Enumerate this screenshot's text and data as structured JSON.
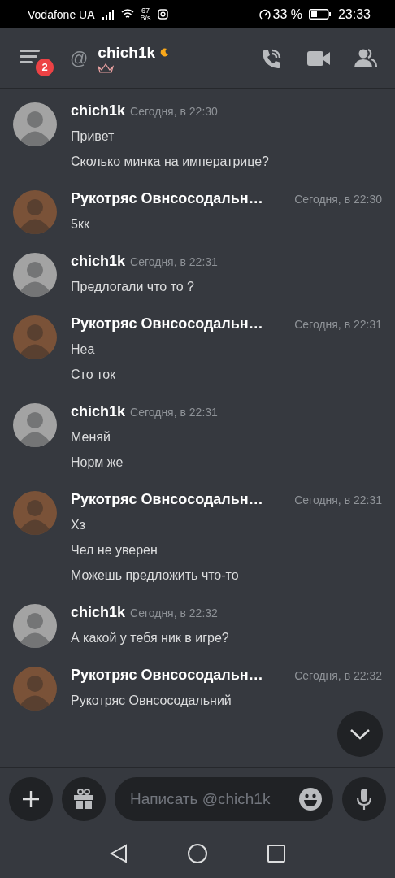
{
  "status_bar": {
    "carrier": "Vodafone UA",
    "speed_value": "67",
    "speed_unit": "B/s",
    "battery": "33 %",
    "time": "23:33"
  },
  "header": {
    "unread_badge": "2",
    "at_sign": "@",
    "title": "chich1k"
  },
  "messages": [
    {
      "author": "chich1k",
      "color": "#a3a3a3",
      "time": "Сегодня, в 22:30",
      "lines": [
        "Привет",
        "Сколько минка на императрице?"
      ]
    },
    {
      "author": "Рукотряс Овнсосодальн…",
      "color": "#7a5238",
      "time": "Сегодня, в 22:30",
      "lines": [
        "5кк"
      ]
    },
    {
      "author": "chich1k",
      "color": "#a3a3a3",
      "time": "Сегодня, в 22:31",
      "lines": [
        "Предлогали что то ?"
      ]
    },
    {
      "author": "Рукотряс Овнсосодальн…",
      "color": "#7a5238",
      "time": "Сегодня, в 22:31",
      "lines": [
        "Неа",
        "Сто ток"
      ]
    },
    {
      "author": "chich1k",
      "color": "#a3a3a3",
      "time": "Сегодня, в 22:31",
      "lines": [
        "Меняй",
        "Норм же"
      ]
    },
    {
      "author": "Рукотряс Овнсосодальн…",
      "color": "#7a5238",
      "time": "Сегодня, в 22:31",
      "lines": [
        "Хз",
        "Чел не уверен",
        "Можешь предложить что-то"
      ]
    },
    {
      "author": "chich1k",
      "color": "#a3a3a3",
      "time": "Сегодня, в 22:32",
      "lines": [
        "А какой у тебя ник в игре?"
      ]
    },
    {
      "author": "Рукотряс Овнсосодальн…",
      "color": "#7a5238",
      "time": "Сегодня, в 22:32",
      "lines": [
        "Рукотряс Овнсосодальний"
      ]
    }
  ],
  "composer": {
    "placeholder": "Написать @chich1k"
  }
}
